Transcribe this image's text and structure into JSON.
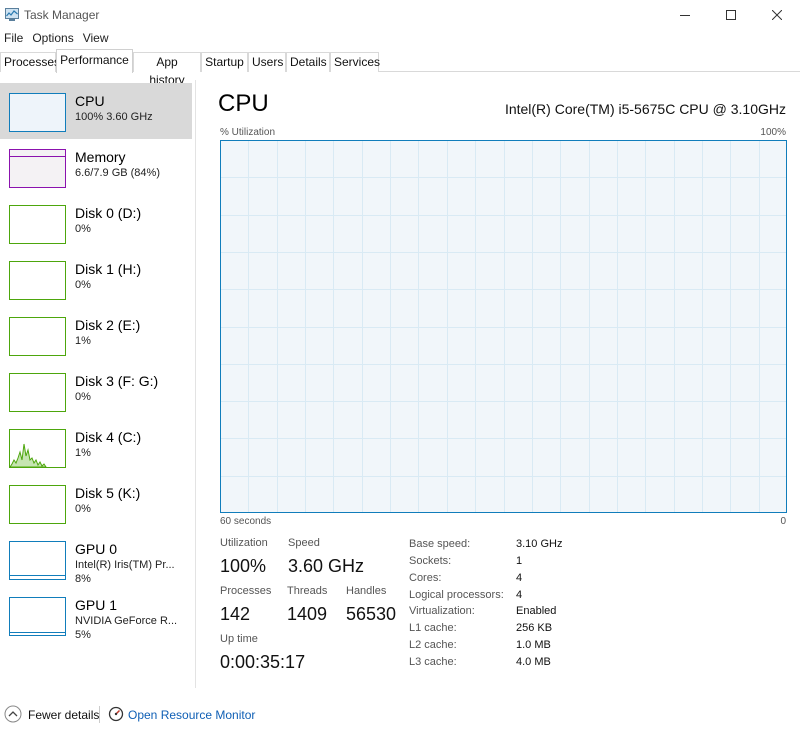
{
  "window": {
    "title": "Task Manager"
  },
  "menu": [
    "File",
    "Options",
    "View"
  ],
  "tabs": [
    "Processes",
    "Performance",
    "App history",
    "Startup",
    "Users",
    "Details",
    "Services"
  ],
  "sidebar": [
    {
      "name": "CPU",
      "sub": "100%  3.60 GHz",
      "sub2": "",
      "color": "#117dbb"
    },
    {
      "name": "Memory",
      "sub": "6.6/7.9 GB (84%)",
      "sub2": "",
      "color": "#8b12ae"
    },
    {
      "name": "Disk 0 (D:)",
      "sub": "0%",
      "sub2": "",
      "color": "#4da60c"
    },
    {
      "name": "Disk 1 (H:)",
      "sub": "0%",
      "sub2": "",
      "color": "#4da60c"
    },
    {
      "name": "Disk 2 (E:)",
      "sub": "1%",
      "sub2": "",
      "color": "#4da60c"
    },
    {
      "name": "Disk 3 (F: G:)",
      "sub": "0%",
      "sub2": "",
      "color": "#4da60c"
    },
    {
      "name": "Disk 4 (C:)",
      "sub": "1%",
      "sub2": "",
      "color": "#4da60c"
    },
    {
      "name": "Disk 5 (K:)",
      "sub": "0%",
      "sub2": "",
      "color": "#4da60c"
    },
    {
      "name": "GPU 0",
      "sub": "Intel(R) Iris(TM) Pr...",
      "sub2": "8%",
      "color": "#117dbb"
    },
    {
      "name": "GPU 1",
      "sub": "NVIDIA GeForce R...",
      "sub2": "5%",
      "color": "#117dbb"
    }
  ],
  "main": {
    "title": "CPU",
    "model": "Intel(R) Core(TM) i5-5675C CPU @ 3.10GHz",
    "util_label": "% Utilization",
    "util_max": "100%",
    "time_label": "60 seconds",
    "time_zero": "0",
    "graph_color": "#117dbb",
    "graph_fill": "#f1f6fa",
    "grid_color": "#d9eaf4"
  },
  "stats": {
    "utilization": {
      "label": "Utilization",
      "value": "100%"
    },
    "speed": {
      "label": "Speed",
      "value": "3.60 GHz"
    },
    "processes": {
      "label": "Processes",
      "value": "142"
    },
    "threads": {
      "label": "Threads",
      "value": "1409"
    },
    "handles": {
      "label": "Handles",
      "value": "56530"
    },
    "uptime": {
      "label": "Up time",
      "value": "0:00:35:17"
    }
  },
  "details": [
    {
      "label": "Base speed:",
      "value": "3.10 GHz"
    },
    {
      "label": "Sockets:",
      "value": "1"
    },
    {
      "label": "Cores:",
      "value": "4"
    },
    {
      "label": "Logical processors:",
      "value": "4"
    },
    {
      "label": "Virtualization:",
      "value": "Enabled"
    },
    {
      "label": "L1 cache:",
      "value": "256 KB"
    },
    {
      "label": "L2 cache:",
      "value": "1.0 MB"
    },
    {
      "label": "L3 cache:",
      "value": "4.0 MB"
    }
  ],
  "bottom": {
    "fewer": "Fewer details",
    "resmon": "Open Resource Monitor"
  }
}
